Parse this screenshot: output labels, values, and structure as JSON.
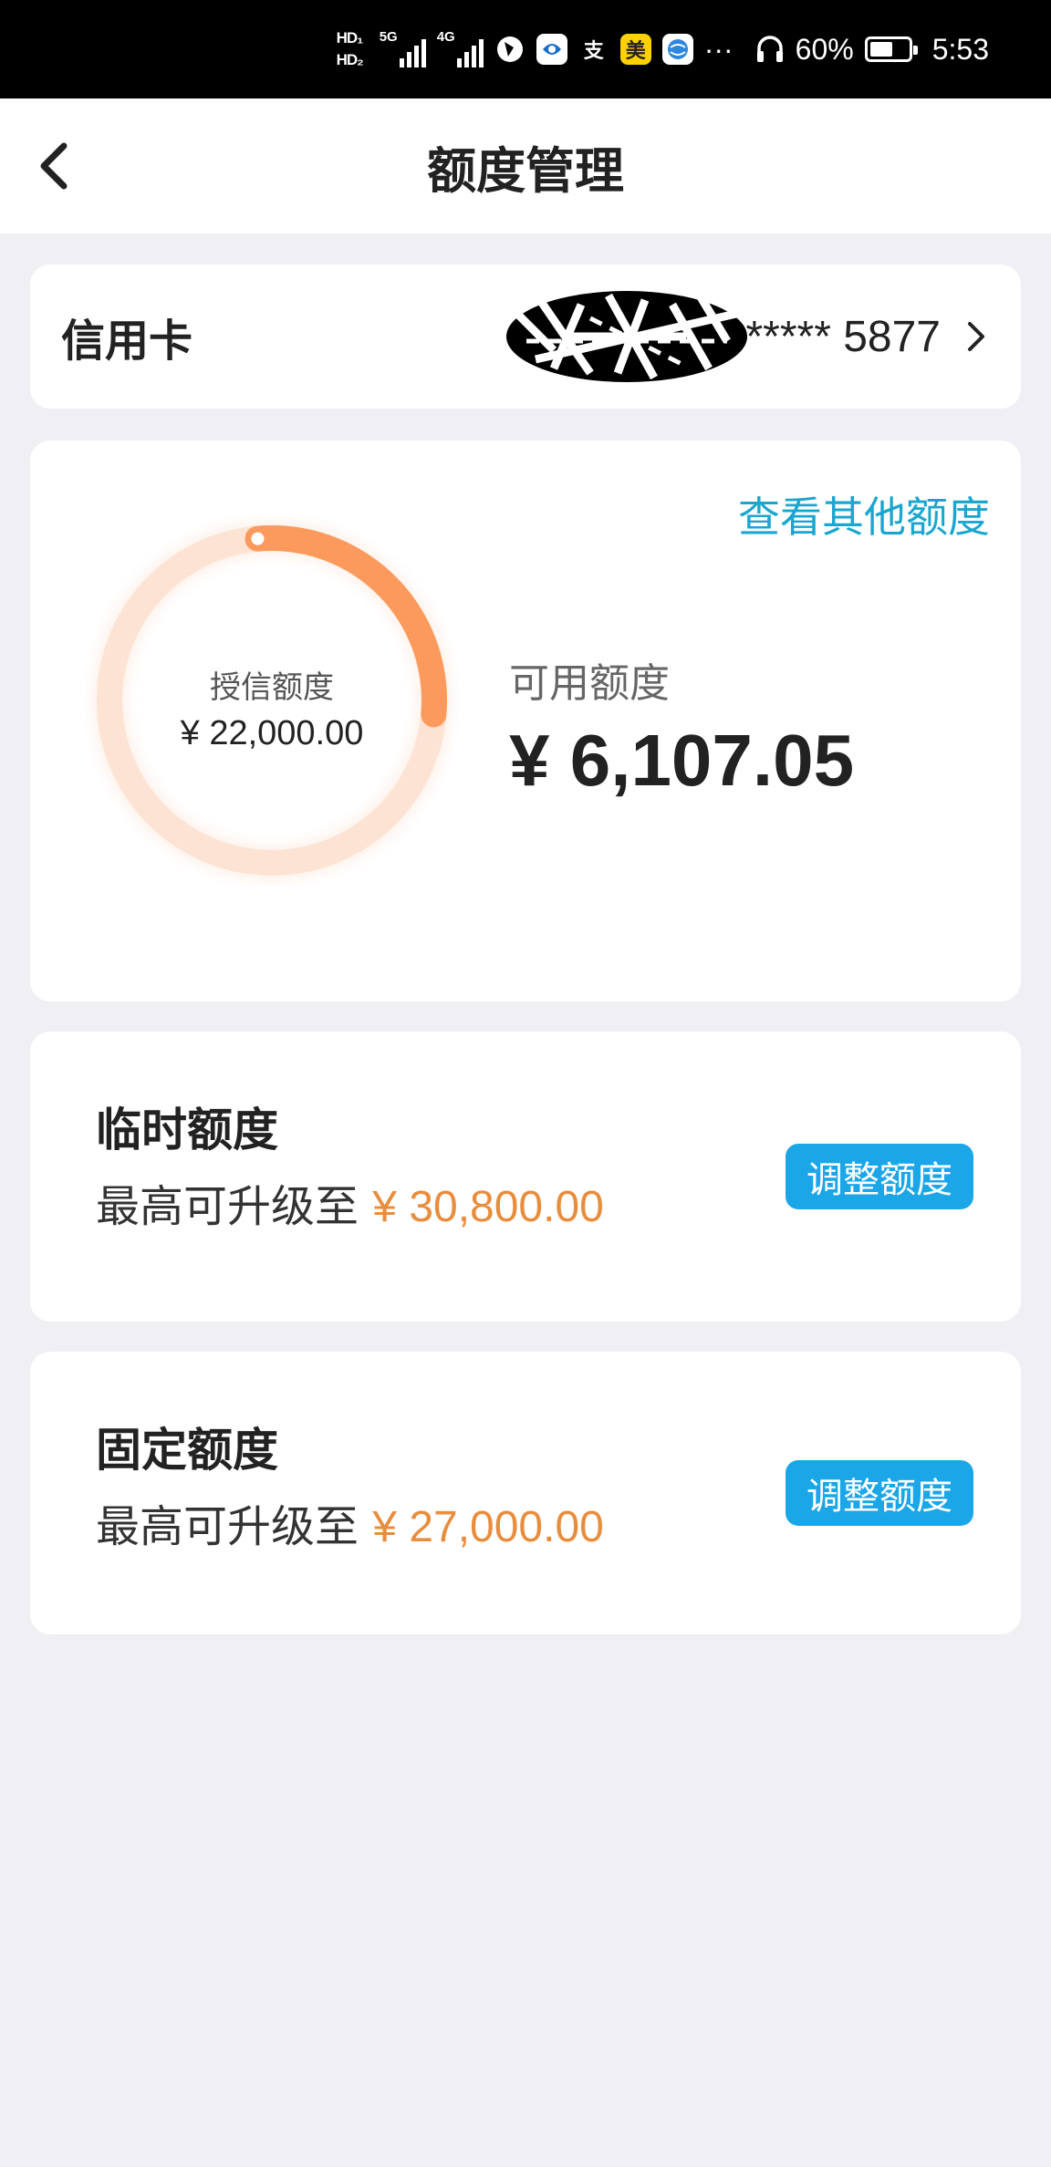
{
  "status_bar": {
    "hd1": "HD₁",
    "hd2": "HD₂",
    "signal1_label": "5G",
    "signal2_label": "4G",
    "app_icons": [
      "browser-icon",
      "bank-app-icon",
      "alipay-icon",
      "meituan-icon",
      "globe-app-icon"
    ],
    "alipay_glyph": "支",
    "meituan_glyph": "美",
    "more": "···",
    "battery": "60%",
    "battery_level": 0.6,
    "time": "5:53"
  },
  "nav": {
    "title": "额度管理"
  },
  "card_selector": {
    "label": "信用卡",
    "number": "***** 5877"
  },
  "credit": {
    "other_link": "查看其他额度",
    "granted_label": "授信额度",
    "granted_value": "¥ 22,000.00",
    "available_label": "可用额度",
    "available_value": "¥ 6,107.05",
    "available_fraction": 0.2776
  },
  "temporary": {
    "title": "临时额度",
    "desc_prefix": "最高可升级至",
    "amount": "¥ 30,800.00",
    "button": "调整额度"
  },
  "fixed": {
    "title": "固定额度",
    "desc_prefix": "最高可升级至",
    "amount": "¥ 27,000.00",
    "button": "调整额度"
  },
  "colors": {
    "accent_blue": "#1ba6e8",
    "link_blue": "#1ba6cf",
    "amount_orange": "#e88d3d",
    "ring_orange": "#fb9a5c",
    "ring_track": "#fde3d3",
    "background": "#efeff4"
  }
}
